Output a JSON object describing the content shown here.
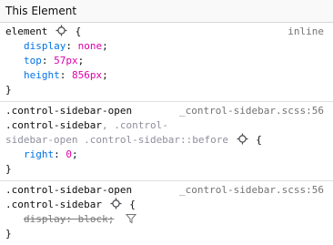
{
  "header": {
    "title": "This Element"
  },
  "rules": [
    {
      "selector": "element",
      "source": "inline",
      "open_brace": "{",
      "close_brace": "}",
      "declarations": [
        {
          "property": "display",
          "value": "none"
        },
        {
          "property": "top",
          "value": "57px"
        },
        {
          "property": "height",
          "value": "856px"
        }
      ]
    },
    {
      "selector_lines": [
        ".control-sidebar-open",
        ".control-sidebar",
        ", .control-",
        "sidebar-open .control-sidebar::before"
      ],
      "source": "_control-sidebar.scss:56",
      "open_brace": "{",
      "close_brace": "}",
      "declarations": [
        {
          "property": "right",
          "value": "0"
        }
      ]
    },
    {
      "selector_lines": [
        ".control-sidebar-open",
        ".control-sidebar"
      ],
      "source": "_control-sidebar.scss:56",
      "open_brace": "{",
      "close_brace": "}",
      "declarations": [
        {
          "property": "display",
          "value": "block",
          "overridden": true
        }
      ]
    }
  ],
  "icons": {
    "node": "target-node-icon",
    "filter": "filter-icon"
  }
}
